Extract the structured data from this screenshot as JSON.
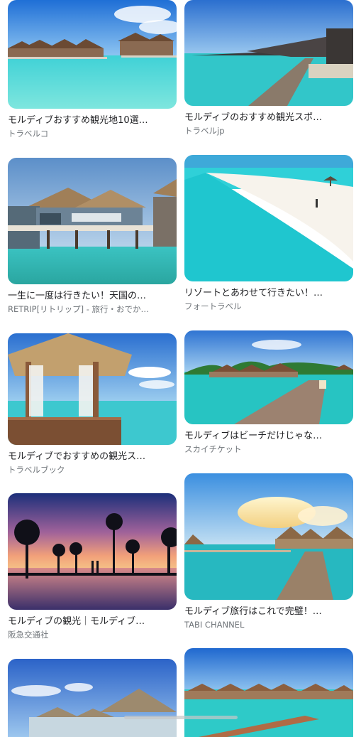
{
  "results": {
    "left": [
      {
        "title": "モルディブおすすめ観光地10選…",
        "source": "トラベルコ"
      },
      {
        "title": "一生に一度は行きたい！天国の…",
        "source": "RETRIP[リトリップ] - 旅行・おでか…"
      },
      {
        "title": "モルディブでおすすめの観光ス…",
        "source": "トラベルブック"
      },
      {
        "title": "モルディブの観光｜モルディブ…",
        "source": "阪急交通社"
      },
      {
        "title": "",
        "source": ""
      }
    ],
    "right": [
      {
        "title": "モルディブのおすすめ観光スポ…",
        "source": "トラベルjp"
      },
      {
        "title": "リゾートとあわせて行きたい！…",
        "source": "フォートラベル"
      },
      {
        "title": "モルディブはビーチだけじゃな…",
        "source": "スカイチケット"
      },
      {
        "title": "モルディブ旅行はこれで完璧！…",
        "source": "TABI CHANNEL"
      },
      {
        "title": "",
        "source": ""
      }
    ]
  }
}
